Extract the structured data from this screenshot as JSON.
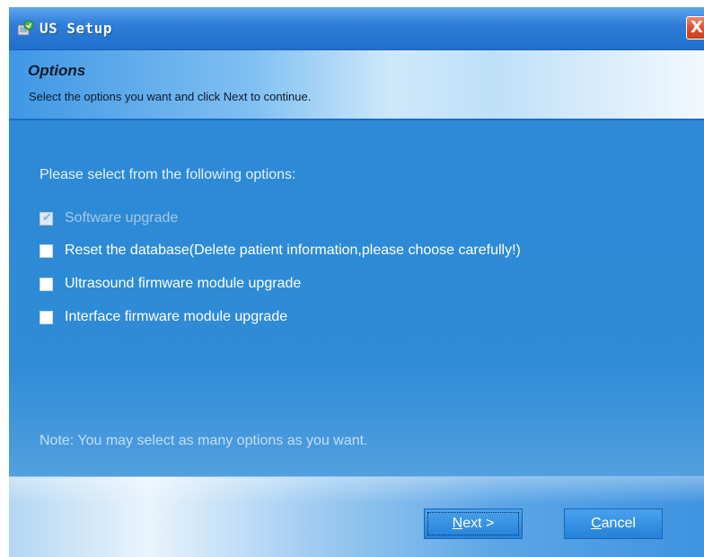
{
  "window": {
    "title": "US Setup",
    "close_label": "X"
  },
  "header": {
    "title": "Options",
    "subtitle": "Select the options you want and click Next to continue."
  },
  "content": {
    "intro": "Please select from the following options:",
    "options": [
      {
        "label": "Software upgrade",
        "checked": true,
        "disabled": true
      },
      {
        "label": "Reset the database(Delete patient information,please choose carefully!)",
        "checked": false,
        "disabled": false
      },
      {
        "label": "Ultrasound firmware module upgrade",
        "checked": false,
        "disabled": false
      },
      {
        "label": "Interface firmware module upgrade",
        "checked": false,
        "disabled": false
      }
    ],
    "note": "Note: You may select as many options as you want."
  },
  "footer": {
    "next": {
      "mnemonic": "N",
      "rest": "ext >"
    },
    "cancel": {
      "mnemonic": "C",
      "rest": "ancel"
    }
  },
  "colors": {
    "title_bar": "#2f7fd8",
    "body_background": "#2f8bd6",
    "button": "#2f8de0",
    "close_button": "#e0502e"
  },
  "icons": {
    "app": "installer-icon",
    "check": "checkmark-icon"
  }
}
